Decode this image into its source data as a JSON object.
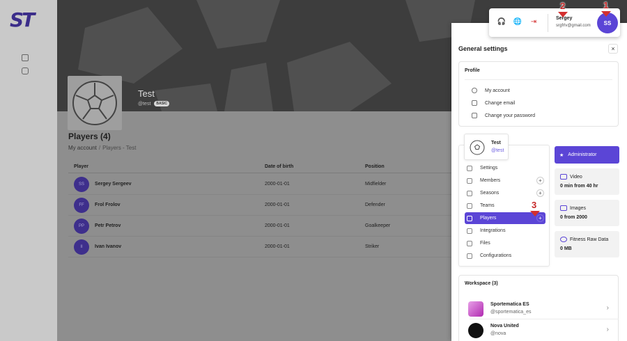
{
  "brand": {
    "logo_text": "ST",
    "accent": "#5b45d6"
  },
  "rail": {
    "icons": [
      "edit-icon",
      "hexagon-icon"
    ]
  },
  "team": {
    "name": "Test",
    "handle": "@test",
    "plan_badge": "BASIC"
  },
  "page": {
    "title": "Players (4)",
    "breadcrumb": {
      "root": "My account",
      "separator": "/",
      "current": "Players - Test"
    }
  },
  "table": {
    "columns": [
      "Player",
      "Date of birth",
      "Position"
    ],
    "rows": [
      {
        "initials": "SS",
        "name": "Sergey Sergeev",
        "dob": "2000-01-01",
        "position": "Midfielder"
      },
      {
        "initials": "FF",
        "name": "Frol Frolov",
        "dob": "2000-01-01",
        "position": "Defender"
      },
      {
        "initials": "PP",
        "name": "Petr Petrov",
        "dob": "2000-01-01",
        "position": "Goalkeeper"
      },
      {
        "initials": "II",
        "name": "Ivan Ivanov",
        "dob": "2000-01-01",
        "position": "Striker"
      }
    ]
  },
  "account": {
    "name": "Sergey",
    "email": "srgfrlv@gmail.com",
    "initials": "SS"
  },
  "settings": {
    "title": "General settings",
    "close": "×",
    "profile": {
      "title": "Profile",
      "links": [
        "My account",
        "Change email",
        "Change your password"
      ]
    },
    "team_card": {
      "name": "Test",
      "handle": "@test"
    },
    "menu": [
      {
        "label": "Settings",
        "plus": false,
        "active": false
      },
      {
        "label": "Members",
        "plus": true,
        "active": false
      },
      {
        "label": "Seasons",
        "plus": true,
        "active": false
      },
      {
        "label": "Teams",
        "plus": false,
        "active": false
      },
      {
        "label": "Players",
        "plus": true,
        "active": true
      },
      {
        "label": "Integrations",
        "plus": false,
        "active": false
      },
      {
        "label": "Files",
        "plus": false,
        "active": false
      },
      {
        "label": "Configurations",
        "plus": false,
        "active": false
      }
    ],
    "role": "Administrator",
    "stats": [
      {
        "label": "Video",
        "value": "0 min from 40 hr"
      },
      {
        "label": "Images",
        "value": "0 from 2000"
      },
      {
        "label": "Fitness Raw Data",
        "value": "0 MB"
      }
    ],
    "workspace": {
      "title": "Workspace (3)",
      "items": [
        {
          "name": "Sportematica ES",
          "handle": "@sportematica_es"
        },
        {
          "name": "Nova United",
          "handle": "@nova"
        }
      ]
    }
  },
  "markers": [
    "1",
    "2",
    "3"
  ]
}
